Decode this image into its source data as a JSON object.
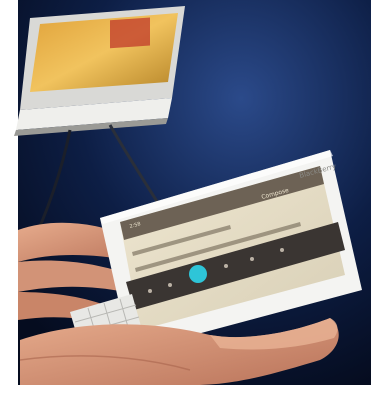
{
  "phone": {
    "brand_logo_text": "BlackBerry",
    "screen_title_text": "Compose",
    "status_text": "2:58"
  },
  "colors": {
    "background_dark": "#071530",
    "background_glow": "#2b4a8a",
    "phone_body": "#f4f4f2",
    "screen_bg": "#e8dfc7",
    "screen_header": "#6d6255",
    "keyboard_bar": "#3a3532",
    "mic_button": "#2ec5d8",
    "skin": "#d99a7c",
    "skin_shadow": "#b56f55"
  }
}
